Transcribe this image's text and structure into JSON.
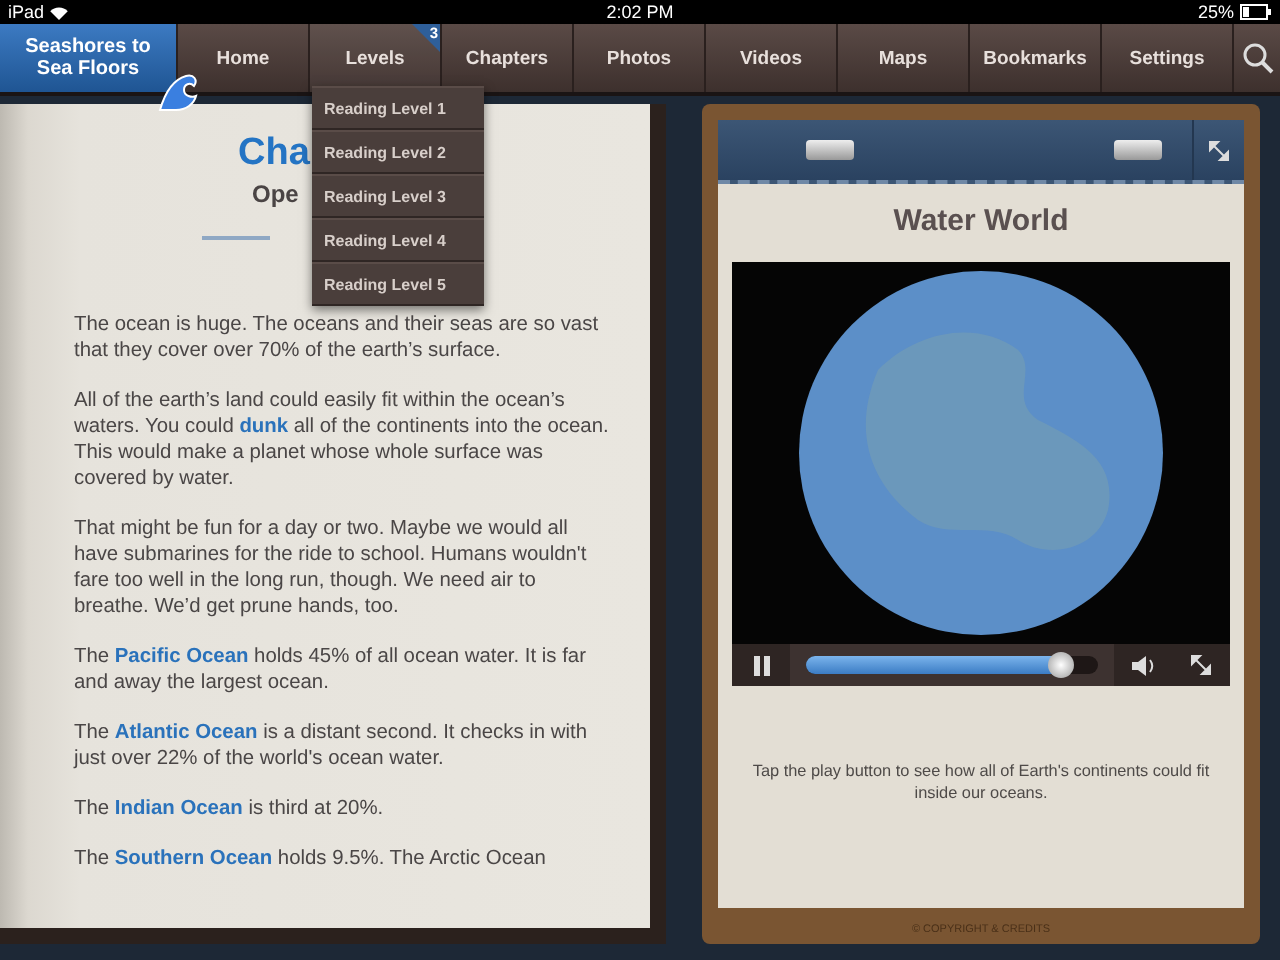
{
  "status_bar": {
    "device": "iPad",
    "time": "2:02 PM",
    "battery": "25%"
  },
  "brand": {
    "title": "Seashores to Sea Floors"
  },
  "nav": {
    "tabs": [
      {
        "label": "Home"
      },
      {
        "label": "Levels",
        "badge": "3",
        "open": true
      },
      {
        "label": "Chapters"
      },
      {
        "label": "Photos"
      },
      {
        "label": "Videos"
      },
      {
        "label": "Maps"
      },
      {
        "label": "Bookmarks"
      },
      {
        "label": "Settings"
      }
    ]
  },
  "levels_menu": [
    "Reading Level 1",
    "Reading Level 2",
    "Reading Level 3",
    "Reading Level 4",
    "Reading Level 5"
  ],
  "page": {
    "title": "Cha",
    "subtitle": "Ope",
    "paragraphs": [
      "The ocean is huge. The oceans and their seas are so vast that they cover over 70% of the earth’s surface.",
      "All of the earth’s land could easily fit within the ocean’s waters. You could **dunk** all of the continents into the ocean. This would make a planet whose whole surface was covered by water.",
      "That might be fun for a day or two. Maybe we would all have submarines for the ride to school. Humans wouldn't fare too well in the long run, though. We need air to breathe. We’d get prune hands, too.",
      "The **Pacific Ocean** holds 45% of all ocean water. It is far and away the largest ocean.",
      "The **Atlantic Ocean** is a distant second. It checks in with just over 22% of the world's ocean water.",
      "The **Indian Ocean** is third at 20%.",
      "The **Southern Ocean** holds 9.5%. The Arctic Ocean"
    ]
  },
  "media": {
    "title": "Water World",
    "playing": true,
    "level": 0.88,
    "caption": "Tap the play button to see how all of Earth's continents could fit inside our oceans.",
    "footer": "© COPYRIGHT & CREDITS"
  }
}
